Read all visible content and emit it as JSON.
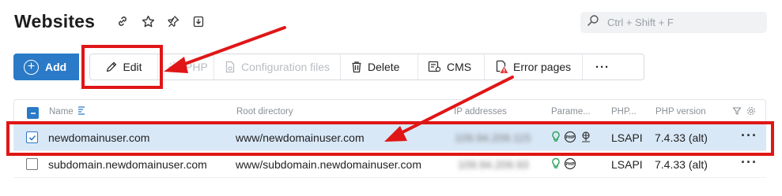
{
  "header": {
    "title": "Websites",
    "icons": [
      "link-icon",
      "star-icon",
      "pin-icon",
      "download-icon"
    ]
  },
  "search": {
    "placeholder": "Ctrl + Shift + F",
    "icon": "search-icon"
  },
  "toolbar": {
    "add_label": "Add",
    "edit_label": "Edit",
    "php_label": "PHP",
    "config_label": "Configuration files",
    "delete_label": "Delete",
    "cms_label": "CMS",
    "error_pages_label": "Error pages",
    "more_label": "···"
  },
  "table": {
    "columns": [
      "Name",
      "Root directory",
      "IP addresses",
      "Parame...",
      "PHP...",
      "PHP version"
    ],
    "rows": [
      {
        "name": "newdomainuser.com",
        "root": "www/newdomainuser.com",
        "ip": "109.94.209.115",
        "php_mode": "LSAPI",
        "php_version": "7.4.33 (alt)",
        "selected": true
      },
      {
        "name": "subdomain.newdomainuser.com",
        "root": "www/subdomain.newdomainuser.com",
        "ip": "109.94.209.93",
        "php_mode": "LSAPI",
        "php_version": "7.4.33 (alt)",
        "selected": false
      }
    ],
    "more_label": "···"
  },
  "colors": {
    "accent": "#2a7ac7",
    "highlight": "#e01616",
    "selected_row": "#d9e8f7",
    "param_green": "#2aa05a"
  }
}
